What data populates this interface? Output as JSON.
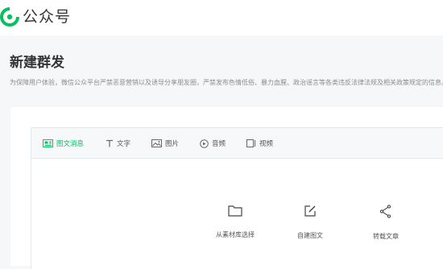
{
  "header": {
    "brand": "公众号",
    "brand_color": "#07c160"
  },
  "page": {
    "title": "新建群发",
    "notice": "为保障用户体验，微信公众平台严禁恶意营销以及诱导分享朋友圈，严禁发布色情低俗、暴力血腥、政治谣言等各类违反法律法规及相关政策规定的信息。"
  },
  "editor": {
    "tabs": [
      {
        "label": "图文消息",
        "icon": "article-icon",
        "active": true
      },
      {
        "label": "文字",
        "icon": "text-icon",
        "active": false
      },
      {
        "label": "图片",
        "icon": "image-icon",
        "active": false
      },
      {
        "label": "音频",
        "icon": "audio-icon",
        "active": false
      },
      {
        "label": "视频",
        "icon": "video-icon",
        "active": false
      }
    ],
    "actions": [
      {
        "label": "从素材库选择",
        "icon": "folder-icon"
      },
      {
        "label": "自建图文",
        "icon": "edit-icon"
      },
      {
        "label": "转载文章",
        "icon": "share-icon"
      }
    ]
  },
  "colors": {
    "accent": "#07c160",
    "page_bg": "#f6f7f9",
    "muted_text": "#8c8c8c"
  }
}
